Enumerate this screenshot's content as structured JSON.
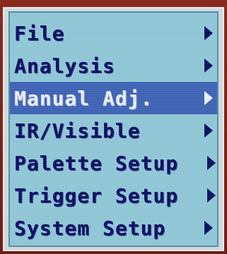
{
  "menu": {
    "items": [
      {
        "label": "File",
        "has_submenu": true,
        "selected": false,
        "icon": "triangle-right-icon"
      },
      {
        "label": "Analysis",
        "has_submenu": true,
        "selected": false,
        "icon": "triangle-right-icon"
      },
      {
        "label": "Manual Adj.",
        "has_submenu": true,
        "selected": true,
        "icon": "triangle-right-icon"
      },
      {
        "label": "IR/Visible",
        "has_submenu": true,
        "selected": false,
        "icon": "triangle-right-icon"
      },
      {
        "label": "Palette Setup",
        "has_submenu": true,
        "selected": false,
        "icon": "triangle-right-icon"
      },
      {
        "label": "Trigger Setup",
        "has_submenu": true,
        "selected": false,
        "icon": "triangle-right-icon"
      },
      {
        "label": "System Setup",
        "has_submenu": true,
        "selected": false,
        "icon": "triangle-right-icon"
      }
    ]
  },
  "colors": {
    "menu_background": "#8fc6d6",
    "menu_text": "#0b1060",
    "selected_background": "#3f63b4",
    "selected_text": "#e8eef8",
    "bezel": "#7a2418"
  }
}
